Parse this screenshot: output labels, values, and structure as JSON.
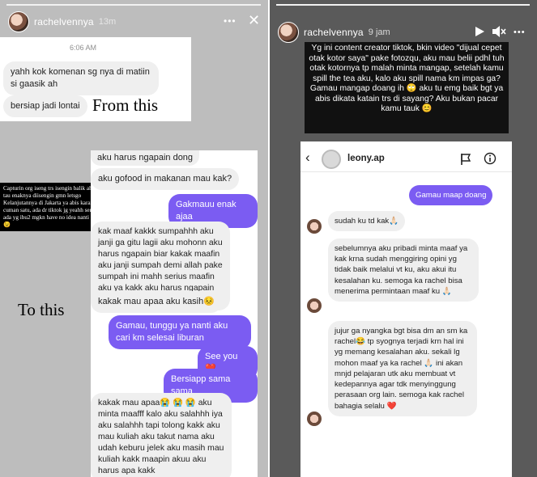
{
  "left_story": {
    "username": "rachelvennya",
    "time": "13m",
    "more_label": "•••",
    "close_label": "✕",
    "dm_top": {
      "timestamp": "6:06 AM",
      "messages": [
        "yahh kok komenan sg nya di matiin si gaasik ah",
        "bersiap jadi lontai"
      ]
    },
    "caption_from": "From this",
    "caption_to": "To this",
    "overlay_caption": "Capturin org iseng trs isengin balik ah, biar tau enaknya diisengin gmn letsgo Kelanjutannya di Jakarta ya abis karantina, ga cuman satu, ada dr tiktok jg yeahh seru guys ada yg ibu2 mgkn have no idea nanti gmn. 😉",
    "dm_mid": {
      "messages": [
        {
          "text": "aku harus ngapain dong",
          "from": "them"
        },
        {
          "text": "aku gofood in makanan mau kak?",
          "from": "them"
        },
        {
          "text": "Gakmauu enak ajaa",
          "from": "me"
        },
        {
          "text": "kak maaf kakkk sumpahhh aku janji ga gitu lagii aku mohonn aku harus ngapain biar kakak maafin aku janji sumpah demi allah pake sumpah ini mahh serius maafin aku ya kakk aku harus ngapain sumpahh",
          "from": "them"
        },
        {
          "text": "kakak mau apaa aku kasih😣",
          "from": "them"
        },
        {
          "text": "Gamau, tunggu ya nanti aku cari km selesai liburan",
          "from": "me"
        },
        {
          "text": "See you ❤️",
          "from": "me"
        },
        {
          "text": "Bersiapp sama sama",
          "from": "me"
        },
        {
          "text": "kakak mau apaa😭 😭 😭 aku minta maafff kalo aku salahhh iya aku salahhh tapi tolong kakk aku mau kuliah aku takut nama aku udah keburu jelek aku masih mau kuliah kakk maapin akuu aku harus apa kakk",
          "from": "them"
        }
      ]
    }
  },
  "right_story": {
    "username": "rachelvennya",
    "time": "9 jam",
    "more_label": "•••",
    "caption": "Yg ini content creator tiktok, bkin video \"dijual cepet otak kotor saya\" pake fotozqu, aku mau belii pdhl tuh otak kotornya tp malah minta mangap, setelah kamu spill the tea aku, kalo aku spill nama km impas ga? Gamau mangap doang ih 🙄 aku tu emg baik bgt ya abis dikata katain trs di sayang? Aku bukan pacar kamu tauk 😊",
    "ig": {
      "handle": "leony.ap",
      "messages": [
        {
          "text": "Gamau maap doang",
          "from": "me"
        },
        {
          "text": "sudah ku td kak🙏🏻",
          "from": "them"
        },
        {
          "text": "sebelumnya aku pribadi minta maaf ya kak krna sudah menggiring opini yg tidak baik melalui vt ku, aku akui itu kesalahan ku. semoga ka rachel bisa menerima permintaan maaf ku 🙏🏻",
          "from": "them"
        },
        {
          "text": "jujur ga nyangka bgt bisa dm an sm ka rachel😂 tp syognya terjadi krn hal ini yg memang kesalahan aku. sekali lg mohon maaf ya ka rachel 🙏🏻 ini akan mnjd pelajaran utk aku membuat vt kedepannya agar tdk menyinggung perasaan org lain. semoga kak rachel bahagia selalu ❤️",
          "from": "them"
        }
      ]
    }
  },
  "colors": {
    "accent_purple": "#7b5cf2",
    "bubble_gray": "#efefef",
    "left_bg": "#bdbdbd",
    "right_bg": "#5a5a5a"
  },
  "icons": [
    "more-icon",
    "close-icon",
    "play-icon",
    "mute-icon",
    "back-arrow-icon",
    "flag-icon",
    "info-icon"
  ]
}
